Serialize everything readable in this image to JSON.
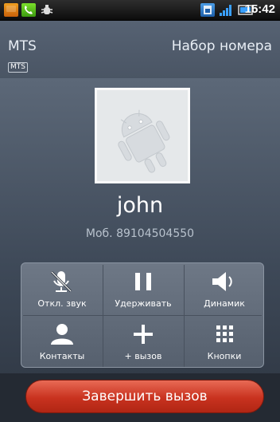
{
  "status_bar": {
    "time": "15:42",
    "icons": [
      "notification-icon",
      "phone-icon",
      "android-debug-icon",
      "sim-icon",
      "signal-icon",
      "battery-icon"
    ]
  },
  "call": {
    "carrier": "MTS",
    "state": "Набор номера",
    "carrier_badge": "MTS",
    "contact_name": "john",
    "number": "Моб. 89104504550"
  },
  "controls": [
    {
      "label": "Откл. звук",
      "icon": "mute-mic-icon"
    },
    {
      "label": "Удерживать",
      "icon": "pause-icon"
    },
    {
      "label": "Динамик",
      "icon": "speaker-icon"
    },
    {
      "label": "Контакты",
      "icon": "contact-icon"
    },
    {
      "label": "+ вызов",
      "icon": "add-call-icon"
    },
    {
      "label": "Кнопки",
      "icon": "dialpad-icon"
    }
  ],
  "end_call_label": "Завершить вызов"
}
